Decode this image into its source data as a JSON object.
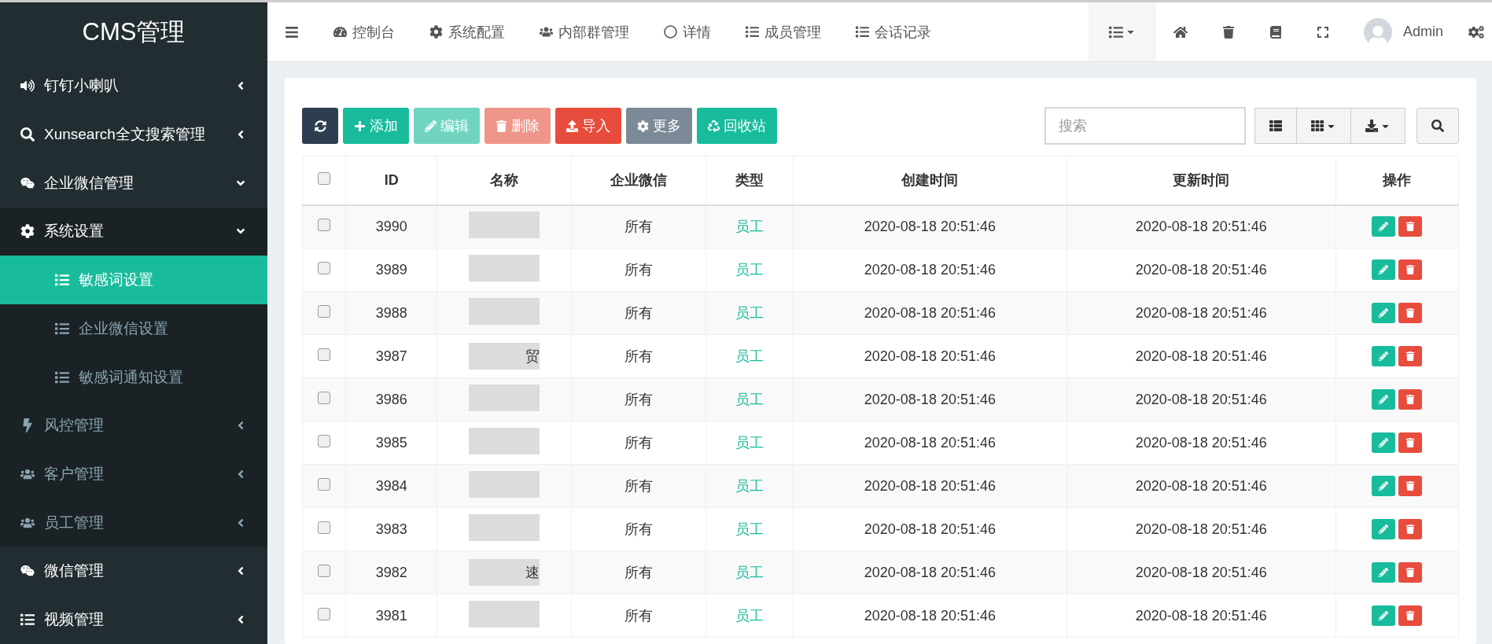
{
  "sidebar": {
    "title": "CMS管理",
    "items": [
      {
        "label": "钉钉小喇叭",
        "kind": "volume",
        "expanded": false
      },
      {
        "label": "Xunsearch全文搜索管理",
        "kind": "search",
        "expanded": false
      },
      {
        "label": "企业微信管理",
        "kind": "wechat",
        "expanded": true,
        "children": [
          {
            "label": "系统设置",
            "kind": "cog",
            "expanded": true,
            "children": [
              {
                "label": "敏感词设置",
                "selected": true
              },
              {
                "label": "企业微信设置",
                "selected": false
              },
              {
                "label": "敏感词通知设置",
                "selected": false
              }
            ]
          },
          {
            "label": "风控管理",
            "kind": "bolt",
            "expanded": false
          },
          {
            "label": "客户管理",
            "kind": "users",
            "expanded": false
          },
          {
            "label": "员工管理",
            "kind": "users",
            "expanded": false
          }
        ]
      },
      {
        "label": "微信管理",
        "kind": "wechat",
        "expanded": false
      },
      {
        "label": "视频管理",
        "kind": "list",
        "expanded": false
      }
    ]
  },
  "nav": {
    "tabs": [
      {
        "label": "控制台",
        "kind": "dashboard"
      },
      {
        "label": "系统配置",
        "kind": "cog"
      },
      {
        "label": "内部群管理",
        "kind": "users"
      },
      {
        "label": "详情",
        "kind": "circle"
      },
      {
        "label": "成员管理",
        "kind": "list"
      },
      {
        "label": "会话记录",
        "kind": "list"
      }
    ],
    "user": "Admin"
  },
  "toolbar": {
    "buttons": [
      {
        "kind": "refresh",
        "color": "#2c3e50"
      },
      {
        "kind": "add",
        "label": "添加",
        "color": "#18bc9c"
      },
      {
        "kind": "edit",
        "label": "编辑",
        "color": "#6fd5c1"
      },
      {
        "kind": "delete",
        "label": "删除",
        "color": "#f0958a"
      },
      {
        "kind": "import",
        "label": "导入",
        "color": "#e74c3c"
      },
      {
        "kind": "more",
        "label": "更多",
        "color": "#7b8a96"
      },
      {
        "kind": "recycle",
        "label": "回收站",
        "color": "#18bc9c"
      }
    ],
    "search": {
      "placeholder": "搜索"
    }
  },
  "table": {
    "select_all": {
      "checked": false
    },
    "columns": [
      "ID",
      "名称",
      "企业微信",
      "类型",
      "创建时间",
      "更新时间",
      "操作"
    ],
    "rows": [
      {
        "checked": false,
        "id": "3990",
        "wechat": "所有",
        "type": "员工",
        "created": "2020-08-18 20:51:46",
        "updated": "2020-08-18 20:51:46"
      },
      {
        "checked": false,
        "id": "3989",
        "wechat": "所有",
        "type": "员工",
        "created": "2020-08-18 20:51:46",
        "updated": "2020-08-18 20:51:46"
      },
      {
        "checked": false,
        "id": "3988",
        "wechat": "所有",
        "type": "员工",
        "created": "2020-08-18 20:51:46",
        "updated": "2020-08-18 20:51:46"
      },
      {
        "checked": false,
        "id": "3987",
        "name": "贸",
        "wechat": "所有",
        "type": "员工",
        "created": "2020-08-18 20:51:46",
        "updated": "2020-08-18 20:51:46"
      },
      {
        "checked": false,
        "id": "3986",
        "wechat": "所有",
        "type": "员工",
        "created": "2020-08-18 20:51:46",
        "updated": "2020-08-18 20:51:46"
      },
      {
        "checked": false,
        "id": "3985",
        "wechat": "所有",
        "type": "员工",
        "created": "2020-08-18 20:51:46",
        "updated": "2020-08-18 20:51:46"
      },
      {
        "checked": false,
        "id": "3984",
        "wechat": "所有",
        "type": "员工",
        "created": "2020-08-18 20:51:46",
        "updated": "2020-08-18 20:51:46"
      },
      {
        "checked": false,
        "id": "3983",
        "wechat": "所有",
        "type": "员工",
        "created": "2020-08-18 20:51:46",
        "updated": "2020-08-18 20:51:46"
      },
      {
        "checked": false,
        "id": "3982",
        "name": "速",
        "wechat": "所有",
        "type": "员工",
        "created": "2020-08-18 20:51:46",
        "updated": "2020-08-18 20:51:46"
      },
      {
        "checked": false,
        "id": "3981",
        "wechat": "所有",
        "type": "员工",
        "created": "2020-08-18 20:51:46",
        "updated": "2020-08-18 20:51:46"
      }
    ]
  }
}
